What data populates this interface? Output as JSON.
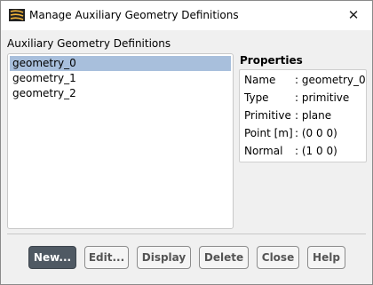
{
  "window": {
    "title": "Manage Auxiliary Geometry Definitions",
    "app_icon": "fluent-app-icon",
    "close_glyph": "✕"
  },
  "list": {
    "label": "Auxiliary Geometry Definitions",
    "items": [
      "geometry_0",
      "geometry_1",
      "geometry_2"
    ],
    "selected_index": 0
  },
  "properties": {
    "title": "Properties",
    "rows": [
      {
        "key": "Name",
        "value": ": geometry_0"
      },
      {
        "key": "Type",
        "value": ": primitive"
      },
      {
        "key": "Primitive",
        "value": ": plane"
      },
      {
        "key": "Point [m]",
        "value": ": (0 0 0)"
      },
      {
        "key": "Normal",
        "value": ": (1 0 0)"
      }
    ]
  },
  "buttons": {
    "new": "New...",
    "edit": "Edit...",
    "display": "Display",
    "delete": "Delete",
    "close": "Close",
    "help": "Help"
  },
  "colors": {
    "selection": "#a8bfdc",
    "primary_button": "#4f5963"
  }
}
